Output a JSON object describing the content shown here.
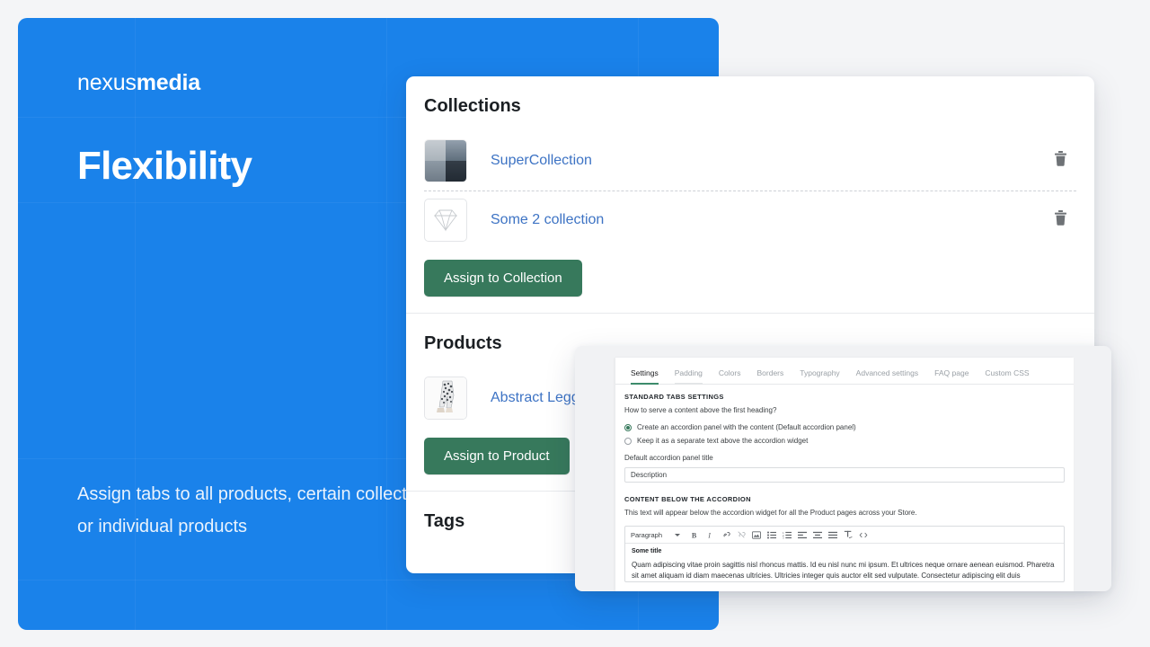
{
  "promo": {
    "brand_light": "nexus",
    "brand_bold": "media",
    "title": "Flexibility",
    "body": "Assign tabs to all products, certain collection(s) or individual products",
    "bg_color": "#1a82ea"
  },
  "card": {
    "collections": {
      "title": "Collections",
      "items": [
        {
          "label": "SuperCollection",
          "thumb": "seascape-thumbnail",
          "delete_icon": "trash-icon"
        },
        {
          "label": "Some 2 collection",
          "thumb": "diamond-thumbnail",
          "delete_icon": "trash-icon"
        }
      ],
      "button": "Assign to Collection"
    },
    "products": {
      "title": "Products",
      "items": [
        {
          "label": "Abstract Leggings",
          "thumb": "leggings-thumbnail"
        }
      ],
      "button": "Assign to Product"
    },
    "tags": {
      "title": "Tags"
    },
    "button_color": "#37795c",
    "link_color": "#3d73c4"
  },
  "settings": {
    "tabs": [
      {
        "label": "Settings",
        "active": true
      },
      {
        "label": "Padding",
        "active": false
      },
      {
        "label": "Colors",
        "active": false
      },
      {
        "label": "Borders",
        "active": false
      },
      {
        "label": "Typography",
        "active": false
      },
      {
        "label": "Advanced settings",
        "active": false
      },
      {
        "label": "FAQ page",
        "active": false
      },
      {
        "label": "Custom CSS",
        "active": false
      }
    ],
    "standard_tabs_heading": "STANDARD TABS SETTINGS",
    "standard_tabs_question": "How to serve a content above the first heading?",
    "radio_options": [
      {
        "label": "Create an accordion panel with the content (Default accordion panel)",
        "checked": true
      },
      {
        "label": "Keep it as a separate text above the accordion widget",
        "checked": false
      }
    ],
    "panel_title_label": "Default accordion panel title",
    "panel_title_value": "Description",
    "content_below_heading": "CONTENT BELOW THE ACCORDION",
    "content_below_desc": "This text will appear below the accordion widget for all the Product pages across your Store.",
    "editor": {
      "format_select": "Paragraph",
      "tools": [
        "bold-icon",
        "italic-icon",
        "link-icon",
        "unlink-icon",
        "image-icon",
        "bullet-list-icon",
        "numbered-list-icon",
        "align-left-icon",
        "align-center-icon",
        "align-justify-icon",
        "clear-format-icon",
        "code-icon"
      ],
      "doc_title": "Some title",
      "doc_body": "Quam adipiscing vitae proin sagittis nisl rhoncus mattis. Id eu nisl nunc mi ipsum. Et ultrices neque ornare aenean euismod. Pharetra sit amet aliquam id diam maecenas ultricies. Ultricies integer quis auctor elit sed vulputate. Consectetur adipiscing elit duis"
    },
    "accent_color": "#3d8b6b"
  }
}
